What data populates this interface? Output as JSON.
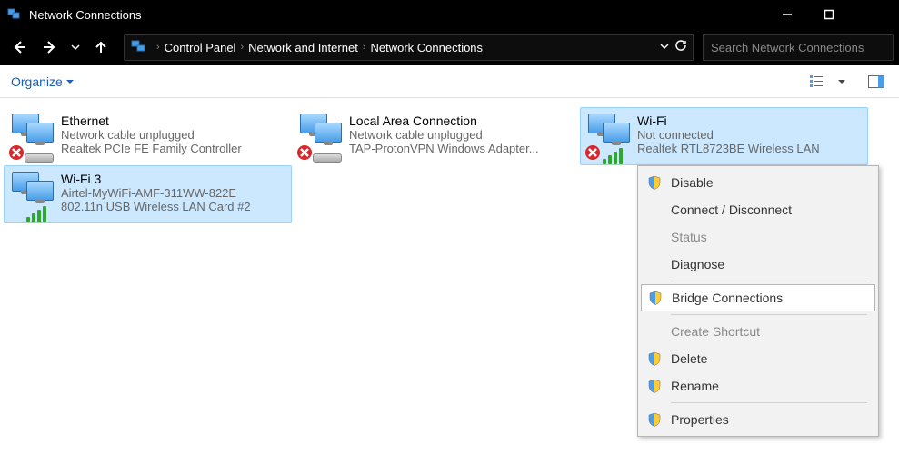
{
  "window": {
    "title": "Network Connections"
  },
  "breadcrumbs": {
    "item0": "Control Panel",
    "item1": "Network and Internet",
    "item2": "Network Connections"
  },
  "search": {
    "placeholder": "Search Network Connections"
  },
  "toolbar": {
    "organize_label": "Organize"
  },
  "connections": [
    {
      "name": "Ethernet",
      "status": "Network cable unplugged",
      "device": "Realtek PCIe FE Family Controller",
      "selected": false,
      "badge": "unplugged",
      "signal": false
    },
    {
      "name": "Local Area Connection",
      "status": "Network cable unplugged",
      "device": "TAP-ProtonVPN Windows Adapter...",
      "selected": false,
      "badge": "unplugged",
      "signal": false
    },
    {
      "name": "Wi-Fi",
      "status": "Not connected",
      "device": "Realtek RTL8723BE Wireless LAN",
      "selected": true,
      "badge": "error",
      "signal": true
    },
    {
      "name": "Wi-Fi 3",
      "status": "Airtel-MyWiFi-AMF-311WW-822E",
      "device": "802.11n USB Wireless LAN Card #2",
      "selected": true,
      "badge": "none",
      "signal": true
    }
  ],
  "context_menu": {
    "items": [
      {
        "label": "Disable",
        "shield": true,
        "enabled": true
      },
      {
        "label": "Connect / Disconnect",
        "shield": false,
        "enabled": true
      },
      {
        "label": "Status",
        "shield": false,
        "enabled": false
      },
      {
        "label": "Diagnose",
        "shield": false,
        "enabled": true
      },
      {
        "sep": true
      },
      {
        "label": "Bridge Connections",
        "shield": true,
        "enabled": true,
        "hover": true
      },
      {
        "sep": true
      },
      {
        "label": "Create Shortcut",
        "shield": false,
        "enabled": false
      },
      {
        "label": "Delete",
        "shield": true,
        "enabled": true
      },
      {
        "label": "Rename",
        "shield": true,
        "enabled": true
      },
      {
        "sep": true
      },
      {
        "label": "Properties",
        "shield": true,
        "enabled": true
      }
    ]
  }
}
